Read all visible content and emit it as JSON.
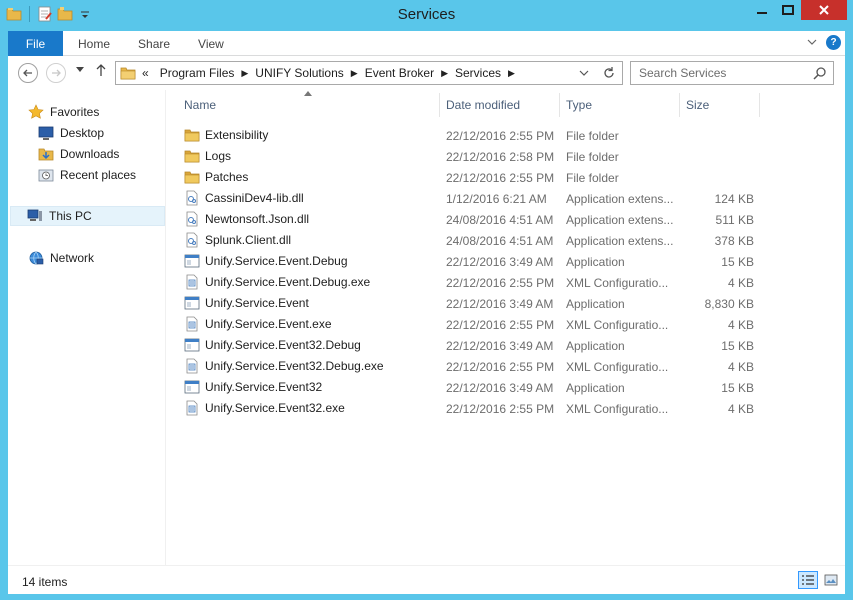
{
  "window": {
    "title": "Services"
  },
  "ribbon": {
    "file_tab": "File",
    "tabs": [
      "Home",
      "Share",
      "View"
    ],
    "help_label": "?"
  },
  "address": {
    "overflow": "«",
    "crumbs": [
      "Program Files",
      "UNIFY Solutions",
      "Event Broker",
      "Services"
    ]
  },
  "search": {
    "placeholder": "Search Services"
  },
  "nav_pane": {
    "favorites": "Favorites",
    "desktop": "Desktop",
    "downloads": "Downloads",
    "recent_places": "Recent places",
    "this_pc": "This PC",
    "network": "Network"
  },
  "columns": {
    "name": "Name",
    "date": "Date modified",
    "type": "Type",
    "size": "Size"
  },
  "files": [
    {
      "name": "Extensibility",
      "date": "22/12/2016 2:55 PM",
      "type": "File folder",
      "size": "",
      "icon": "folder"
    },
    {
      "name": "Logs",
      "date": "22/12/2016 2:58 PM",
      "type": "File folder",
      "size": "",
      "icon": "folder"
    },
    {
      "name": "Patches",
      "date": "22/12/2016 2:55 PM",
      "type": "File folder",
      "size": "",
      "icon": "folder"
    },
    {
      "name": "CassiniDev4-lib.dll",
      "date": "1/12/2016 6:21 AM",
      "type": "Application extens...",
      "size": "124 KB",
      "icon": "dll"
    },
    {
      "name": "Newtonsoft.Json.dll",
      "date": "24/08/2016 4:51 AM",
      "type": "Application extens...",
      "size": "511 KB",
      "icon": "dll"
    },
    {
      "name": "Splunk.Client.dll",
      "date": "24/08/2016 4:51 AM",
      "type": "Application extens...",
      "size": "378 KB",
      "icon": "dll"
    },
    {
      "name": "Unify.Service.Event.Debug",
      "date": "22/12/2016 3:49 AM",
      "type": "Application",
      "size": "15 KB",
      "icon": "app"
    },
    {
      "name": "Unify.Service.Event.Debug.exe",
      "date": "22/12/2016 2:55 PM",
      "type": "XML Configuratio...",
      "size": "4 KB",
      "icon": "config"
    },
    {
      "name": "Unify.Service.Event",
      "date": "22/12/2016 3:49 AM",
      "type": "Application",
      "size": "8,830 KB",
      "icon": "app"
    },
    {
      "name": "Unify.Service.Event.exe",
      "date": "22/12/2016 2:55 PM",
      "type": "XML Configuratio...",
      "size": "4 KB",
      "icon": "config"
    },
    {
      "name": "Unify.Service.Event32.Debug",
      "date": "22/12/2016 3:49 AM",
      "type": "Application",
      "size": "15 KB",
      "icon": "app"
    },
    {
      "name": "Unify.Service.Event32.Debug.exe",
      "date": "22/12/2016 2:55 PM",
      "type": "XML Configuratio...",
      "size": "4 KB",
      "icon": "config"
    },
    {
      "name": "Unify.Service.Event32",
      "date": "22/12/2016 3:49 AM",
      "type": "Application",
      "size": "15 KB",
      "icon": "app"
    },
    {
      "name": "Unify.Service.Event32.exe",
      "date": "22/12/2016 2:55 PM",
      "type": "XML Configuratio...",
      "size": "4 KB",
      "icon": "config"
    }
  ],
  "status": {
    "item_count": "14 items"
  },
  "colors": {
    "titlebar": "#59c6ea",
    "file_tab": "#1979ca",
    "close": "#c7302b",
    "selection": "#e5f3fb",
    "folder": "#e8b84a"
  }
}
